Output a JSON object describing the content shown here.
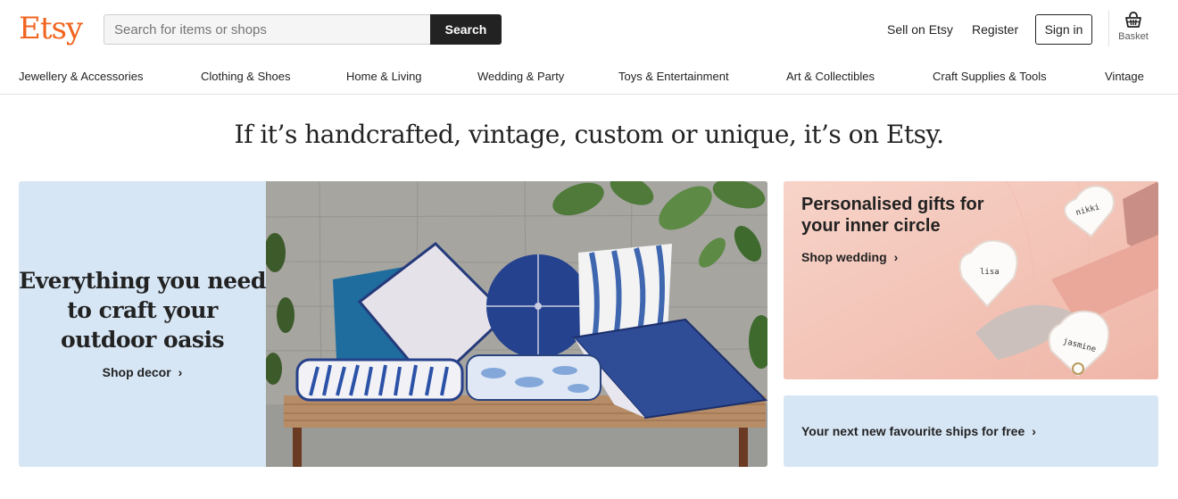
{
  "brand": {
    "logo_text": "Etsy",
    "accent_color": "#F1641E"
  },
  "search": {
    "placeholder": "Search for items or shops",
    "value": "",
    "button_label": "Search"
  },
  "header": {
    "sell_label": "Sell on Etsy",
    "register_label": "Register",
    "signin_label": "Sign in",
    "basket_label": "Basket",
    "basket_icon": "basket-icon"
  },
  "nav": {
    "items": [
      "Jewellery & Accessories",
      "Clothing & Shoes",
      "Home & Living",
      "Wedding & Party",
      "Toys & Entertainment",
      "Art & Collectibles",
      "Craft Supplies & Tools",
      "Vintage"
    ]
  },
  "tagline": "If it’s handcrafted, vintage, custom or unique, it’s on Etsy.",
  "hero": {
    "heading": "Everything you need to craft your outdoor oasis",
    "link": "Shop decor",
    "background": "#d7e6f5"
  },
  "gifts": {
    "heading": "Personalised gifts for your inner circle",
    "link": "Shop wedding",
    "dish_names": [
      "nikki",
      "lisa",
      "jasmine"
    ]
  },
  "shipping": {
    "link": "Your next new favourite ships for free",
    "background": "#d7e6f5"
  },
  "chevron_glyph": "›"
}
